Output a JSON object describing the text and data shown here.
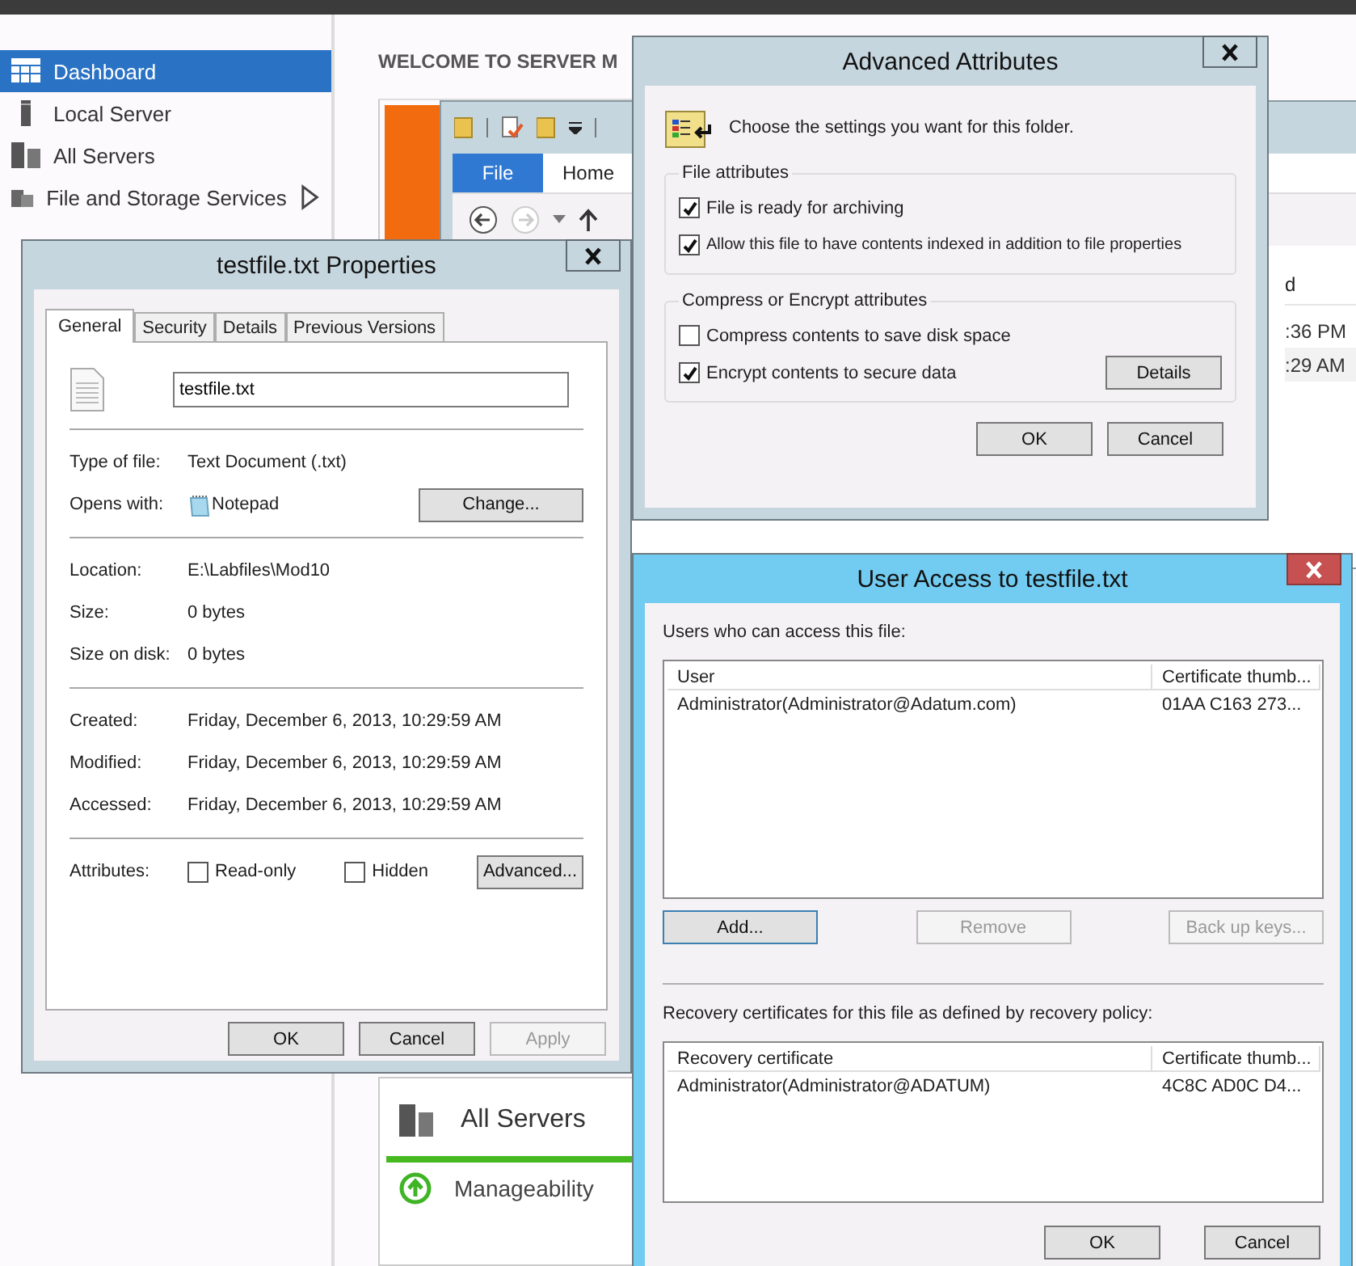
{
  "sidebar": {
    "items": [
      {
        "label": "Dashboard",
        "selected": true,
        "expandable": false
      },
      {
        "label": "Local Server",
        "selected": false,
        "expandable": false
      },
      {
        "label": "All Servers",
        "selected": false,
        "expandable": false
      },
      {
        "label": "File and Storage Services",
        "selected": false,
        "expandable": true
      }
    ]
  },
  "main": {
    "heading": "WELCOME TO SERVER M",
    "card": {
      "title": "All Servers",
      "rows": [
        {
          "label": "Manageability"
        }
      ]
    }
  },
  "explorer": {
    "ribbon_tabs": [
      {
        "label": "File",
        "selected": true
      },
      {
        "label": "Home",
        "selected": false
      }
    ],
    "column_fragment": "d",
    "time_fragments": [
      ":36 PM",
      ":29 AM"
    ]
  },
  "properties_dialog": {
    "title": "testfile.txt Properties",
    "active": false,
    "tabs": [
      {
        "label": "General",
        "selected": true
      },
      {
        "label": "Security",
        "selected": false
      },
      {
        "label": "Details",
        "selected": false
      },
      {
        "label": "Previous Versions",
        "selected": false
      }
    ],
    "file_name": "testfile.txt",
    "sections": [
      {
        "rows": [
          {
            "label": "Type of file:",
            "value": "Text Document (.txt)"
          },
          {
            "label": "Opens with:",
            "value": "Notepad",
            "kind": "app",
            "button": "Change..."
          }
        ]
      },
      {
        "rows": [
          {
            "label": "Location:",
            "value": "E:\\Labfiles\\Mod10"
          },
          {
            "label": "Size:",
            "value": "0 bytes"
          },
          {
            "label": "Size on disk:",
            "value": "0 bytes"
          }
        ]
      },
      {
        "rows": [
          {
            "label": "Created:",
            "value": "Friday, December 6, 2013, 10:29:59 AM"
          },
          {
            "label": "Modified:",
            "value": "Friday, December 6, 2013, 10:29:59 AM"
          },
          {
            "label": "Accessed:",
            "value": "Friday, December 6, 2013, 10:29:59 AM"
          }
        ]
      }
    ],
    "attributes": {
      "label": "Attributes:",
      "options": [
        {
          "label": "Read-only",
          "checked": false
        },
        {
          "label": "Hidden",
          "checked": false
        }
      ],
      "button": "Advanced..."
    },
    "buttons": [
      {
        "label": "OK",
        "disabled": false
      },
      {
        "label": "Cancel",
        "disabled": false
      },
      {
        "label": "Apply",
        "disabled": true
      }
    ]
  },
  "advanced_dialog": {
    "title": "Advanced Attributes",
    "active": false,
    "prompt": "Choose the settings you want for this folder.",
    "groups": [
      {
        "title": "File attributes",
        "options": [
          {
            "label": "File is ready for archiving",
            "checked": true
          },
          {
            "label": "Allow this file to have contents indexed in addition to file properties",
            "checked": true
          }
        ]
      },
      {
        "title": "Compress or Encrypt attributes",
        "options": [
          {
            "label": "Compress contents to save disk space",
            "checked": false
          },
          {
            "label": "Encrypt contents to secure data",
            "checked": true,
            "button": "Details"
          }
        ]
      }
    ],
    "buttons": [
      {
        "label": "OK",
        "disabled": false
      },
      {
        "label": "Cancel",
        "disabled": false
      }
    ]
  },
  "user_access_dialog": {
    "title": "User Access to testfile.txt",
    "active": true,
    "users_label": "Users who can access this file:",
    "users_table": {
      "columns": [
        "User",
        "Certificate thumb..."
      ],
      "rows": [
        [
          "Administrator(Administrator@Adatum.com)",
          "01AA C163 273..."
        ]
      ]
    },
    "user_buttons": [
      {
        "label": "Add...",
        "disabled": false,
        "focused": true
      },
      {
        "label": "Remove",
        "disabled": true,
        "focused": false
      },
      {
        "label": "Back up keys...",
        "disabled": true,
        "focused": false
      }
    ],
    "recovery_label": "Recovery certificates for this file as defined by recovery policy:",
    "recovery_table": {
      "columns": [
        "Recovery certificate",
        "Certificate thumb..."
      ],
      "rows": [
        [
          "Administrator(Administrator@ADATUM)",
          "4C8C AD0C D4..."
        ]
      ]
    },
    "buttons": [
      {
        "label": "OK",
        "disabled": false
      },
      {
        "label": "Cancel",
        "disabled": false
      }
    ]
  }
}
